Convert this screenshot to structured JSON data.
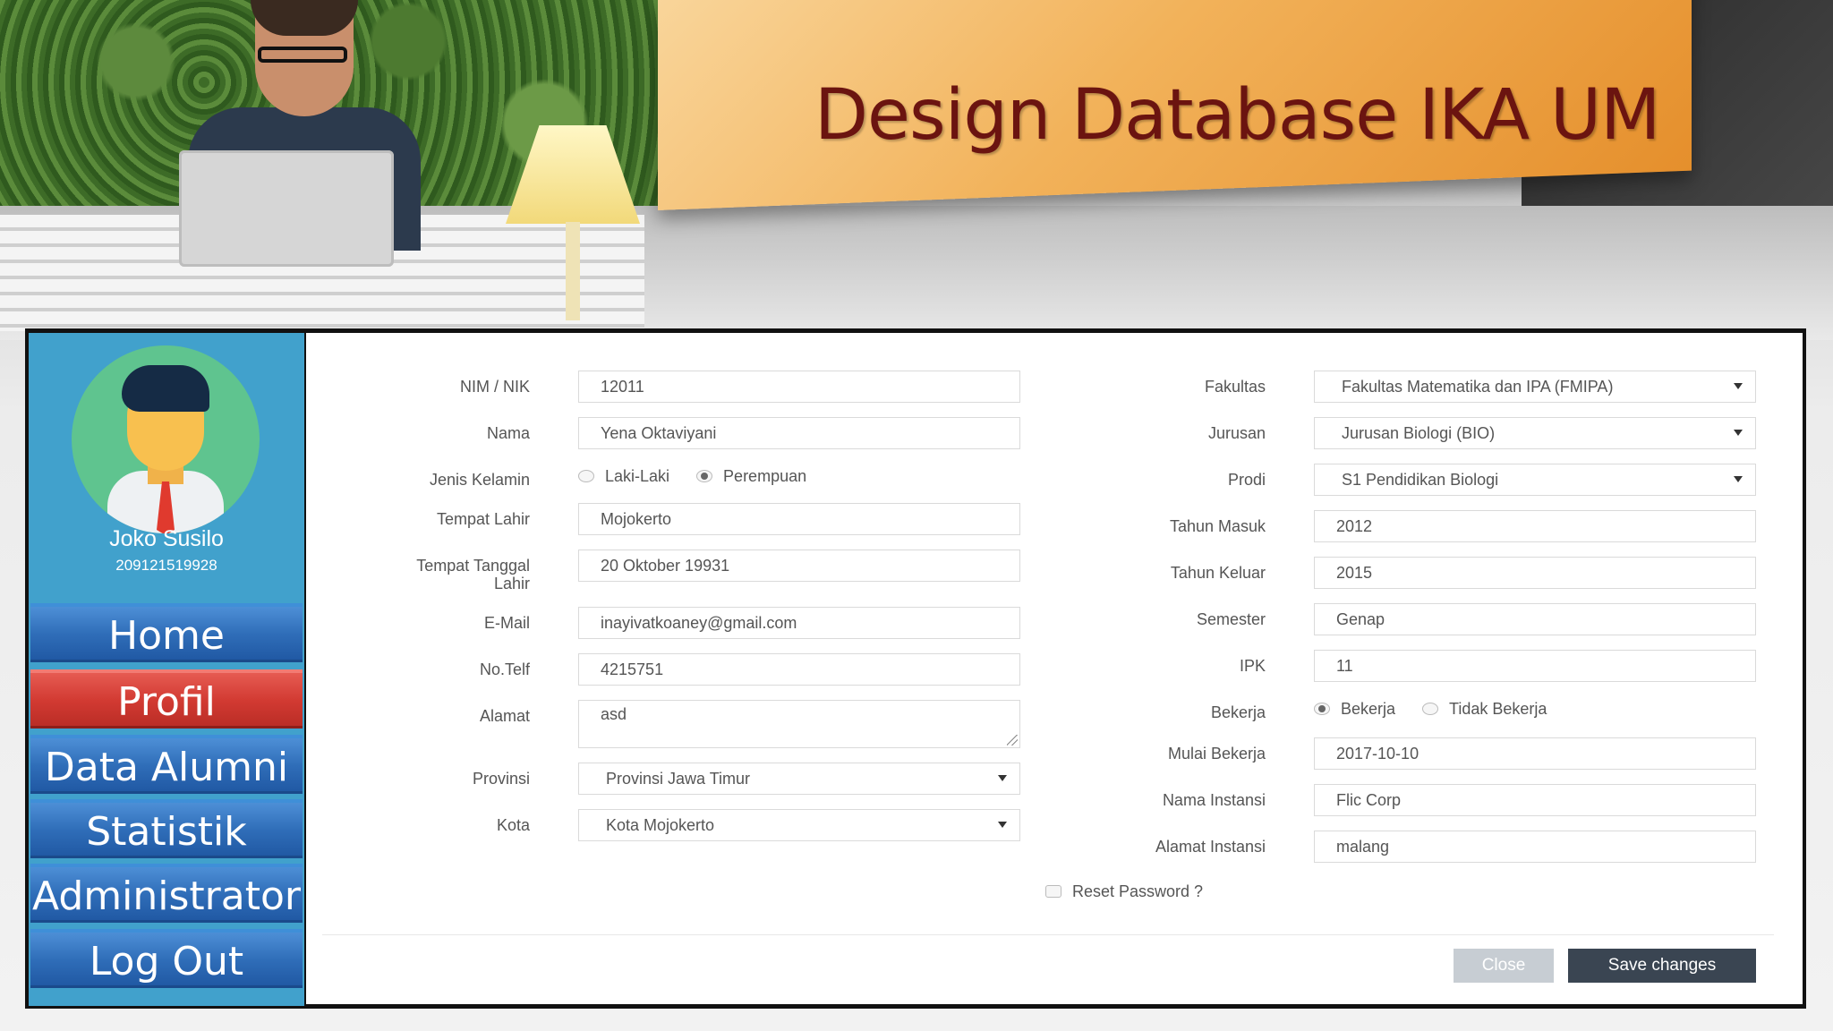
{
  "slide": {
    "title": "Design Database IKA UM"
  },
  "sidebar": {
    "user_name": "Joko Susilo",
    "user_id": "209121519928",
    "items": [
      {
        "label": "Home",
        "active": false
      },
      {
        "label": "Profil",
        "active": true
      },
      {
        "label": "Data Alumni",
        "active": false
      },
      {
        "label": "Statistik",
        "active": false
      },
      {
        "label": "Administrator",
        "active": false
      },
      {
        "label": "Log Out",
        "active": false
      }
    ]
  },
  "form": {
    "left": {
      "nim_label": "NIM / NIK",
      "nim_value": "12011",
      "nama_label": "Nama",
      "nama_value": "Yena Oktaviyani",
      "jk_label": "Jenis Kelamin",
      "jk_options": [
        "Laki-Laki",
        "Perempuan"
      ],
      "jk_selected": "Perempuan",
      "tempat_label": "Tempat Lahir",
      "tempat_value": "Mojokerto",
      "ttl_label_1": "Tempat Tanggal",
      "ttl_label_2": "Lahir",
      "ttl_value": "20 Oktober 19931",
      "email_label": "E-Mail",
      "email_value": "inayivatkoaney@gmail.com",
      "telf_label": "No.Telf",
      "telf_value": "4215751",
      "alamat_label": "Alamat",
      "alamat_value": "asd",
      "provinsi_label": "Provinsi",
      "provinsi_value": "Provinsi Jawa Timur",
      "kota_label": "Kota",
      "kota_value": "Kota Mojokerto"
    },
    "right": {
      "fakultas_label": "Fakultas",
      "fakultas_value": "Fakultas Matematika dan IPA (FMIPA)",
      "jurusan_label": "Jurusan",
      "jurusan_value": "Jurusan Biologi (BIO)",
      "prodi_label": "Prodi",
      "prodi_value": "S1 Pendidikan Biologi",
      "masuk_label": "Tahun Masuk",
      "masuk_value": "2012",
      "keluar_label": "Tahun Keluar",
      "keluar_value": "2015",
      "semester_label": "Semester",
      "semester_value": "Genap",
      "ipk_label": "IPK",
      "ipk_value": "11",
      "bekerja_label": "Bekerja",
      "bekerja_options": [
        "Bekerja",
        "Tidak Bekerja"
      ],
      "bekerja_selected": "Bekerja",
      "mulai_label": "Mulai Bekerja",
      "mulai_value": "2017-10-10",
      "instansi_label": "Nama Instansi",
      "instansi_value": "Flic Corp",
      "alamat_instansi_label": "Alamat Instansi",
      "alamat_instansi_value": "malang"
    },
    "reset_password_label": "Reset Password ?",
    "close_label": "Close",
    "save_label": "Save changes"
  },
  "colors": {
    "sidebar_bg": "#41a1cc",
    "nav_blue": "#2f6db8",
    "nav_active_red": "#d23a32",
    "title_text": "#6b1410",
    "save_button": "#3a4552",
    "close_button": "#c7cdd3"
  }
}
